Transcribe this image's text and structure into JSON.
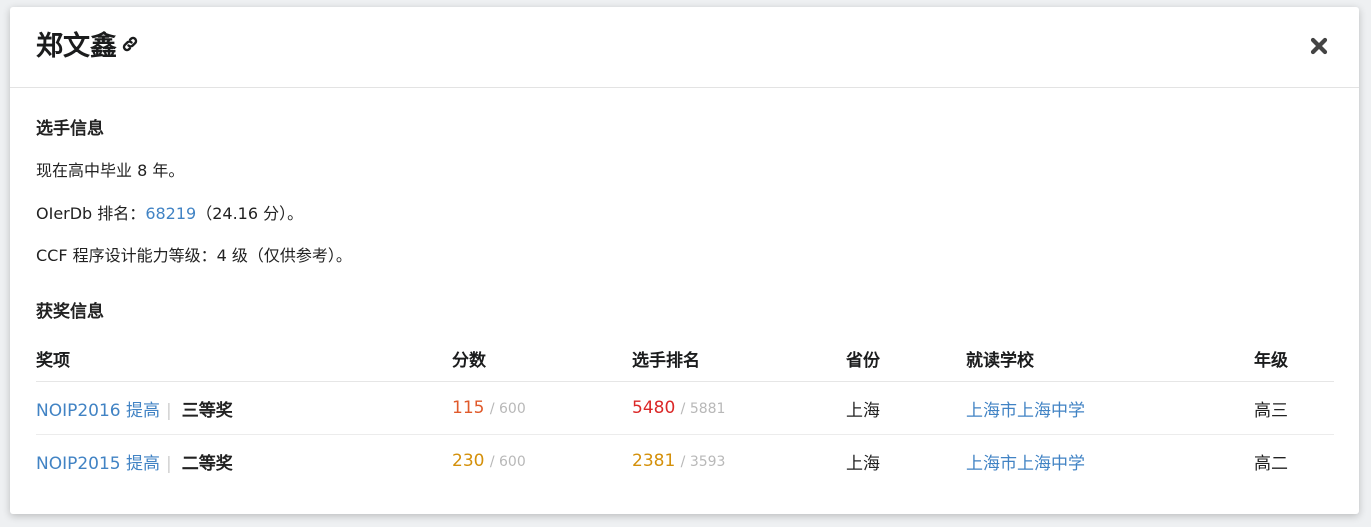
{
  "modal": {
    "title": "郑文鑫",
    "section_player": "选手信息",
    "graduation_text": "现在高中毕业 8 年。",
    "oierdb_prefix": "OIerDb 排名：",
    "oierdb_rank": "68219",
    "oierdb_suffix": "（24.16 分）。",
    "ccf_text": "CCF 程序设计能力等级：4 级（仅供参考）。",
    "section_awards": "获奖信息"
  },
  "table": {
    "headers": {
      "award": "奖项",
      "score": "分数",
      "rank": "选手排名",
      "province": "省份",
      "school": "就读学校",
      "grade": "年级"
    },
    "rows": [
      {
        "contest": "NOIP2016 提高",
        "sep": "|",
        "prize": "三等奖",
        "score": "115",
        "score_total": "/ 600",
        "score_color": "#e05a2b",
        "rank": "5480",
        "rank_total": "/ 5881",
        "rank_color": "#db2828",
        "province": "上海",
        "school": "上海市上海中学",
        "grade": "高三"
      },
      {
        "contest": "NOIP2015 提高",
        "sep": "|",
        "prize": "二等奖",
        "score": "230",
        "score_total": "/ 600",
        "score_color": "#d4900a",
        "rank": "2381",
        "rank_total": "/ 3593",
        "rank_color": "#d4900a",
        "province": "上海",
        "school": "上海市上海中学",
        "grade": "高二"
      }
    ]
  },
  "icons": {
    "link": "link-icon",
    "close": "close-icon"
  },
  "colors": {
    "link": "#4183c4",
    "muted": "#b8b8b8"
  }
}
